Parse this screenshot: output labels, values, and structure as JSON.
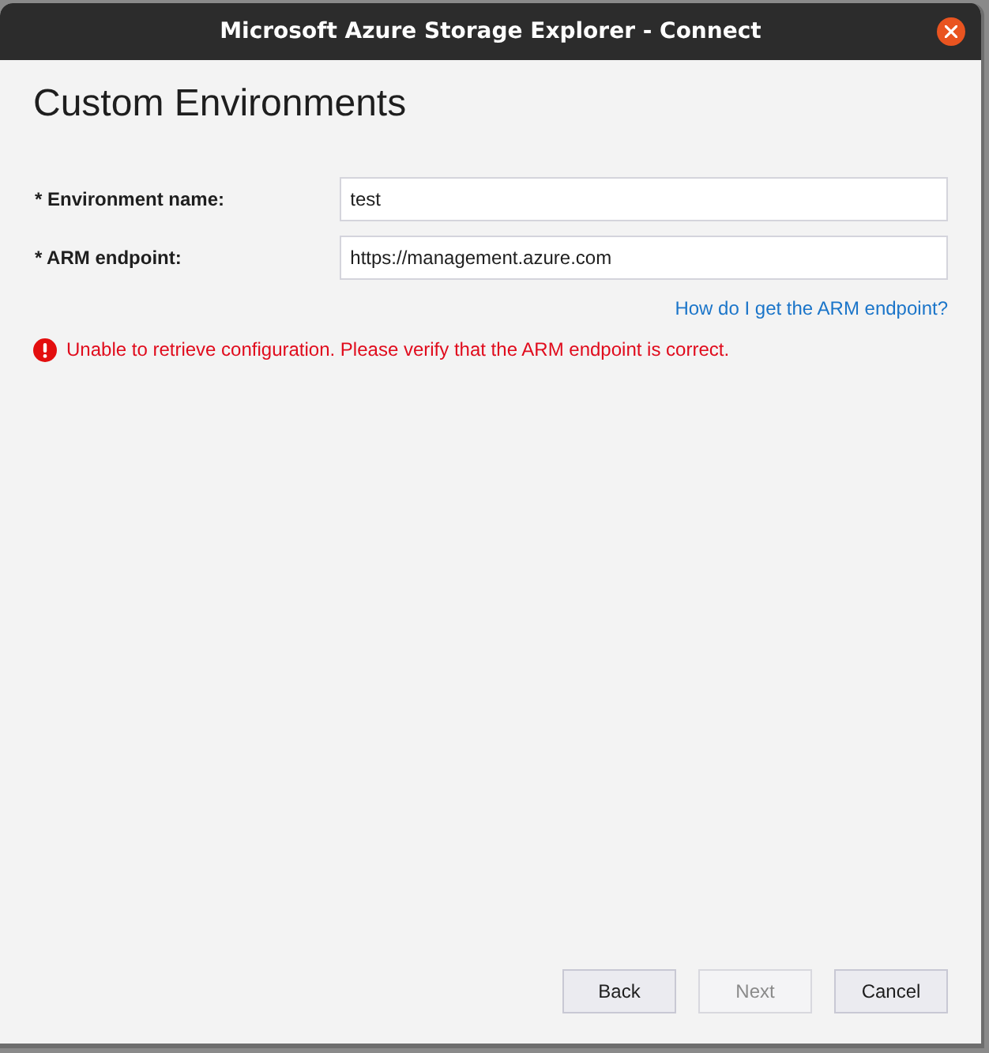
{
  "window": {
    "title": "Microsoft Azure Storage Explorer - Connect"
  },
  "heading": "Custom Environments",
  "fields": [
    {
      "label": "* Environment name:",
      "value": "test"
    },
    {
      "label": "* ARM endpoint:",
      "value": "https://management.azure.com"
    }
  ],
  "help_link": "How do I get the ARM endpoint?",
  "error": "Unable to retrieve configuration. Please verify that the ARM endpoint is correct.",
  "buttons": [
    {
      "label": "Back",
      "disabled": false
    },
    {
      "label": "Next",
      "disabled": true
    },
    {
      "label": "Cancel",
      "disabled": false
    }
  ]
}
